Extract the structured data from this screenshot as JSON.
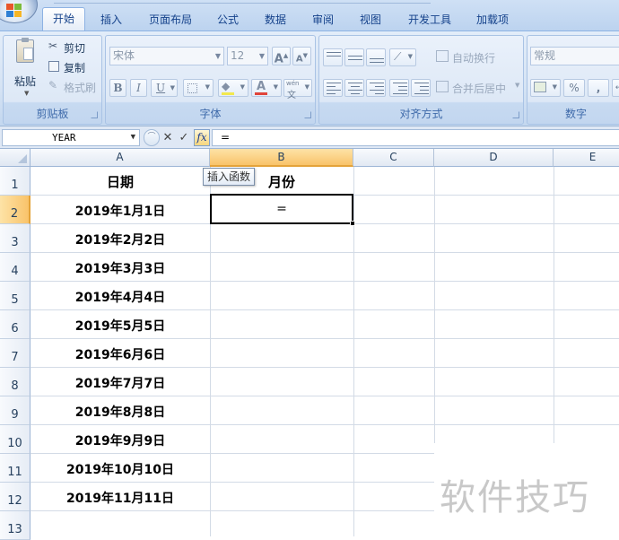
{
  "ribbon": {
    "tabs": [
      "开始",
      "插入",
      "页面布局",
      "公式",
      "数据",
      "审阅",
      "视图",
      "开发工具",
      "加载项"
    ],
    "active_tab": "开始",
    "clipboard": {
      "paste_label": "粘贴",
      "cut_label": "剪切",
      "copy_label": "复制",
      "format_painter_label": "格式刷",
      "group_label": "剪贴板"
    },
    "font": {
      "font_name": "宋体",
      "font_size": "12",
      "bold": "B",
      "italic": "I",
      "underline": "U",
      "grow": "A",
      "shrink": "A",
      "font_color_glyph": "A",
      "wen": "wén",
      "group_label": "字体"
    },
    "alignment": {
      "wrap_text_label": "自动换行",
      "merge_center_label": "合并后居中",
      "group_label": "对齐方式"
    },
    "number": {
      "format_value": "常规",
      "percent": "%",
      "comma": ",",
      "group_label": "数字"
    }
  },
  "formula_bar": {
    "name_box": "YEAR",
    "cancel_glyph": "✕",
    "enter_glyph": "✓",
    "fx_label": "fx",
    "formula": "="
  },
  "tooltip": "插入函数",
  "sheet": {
    "columns": [
      "A",
      "B",
      "C",
      "D",
      "E"
    ],
    "selected_column": "B",
    "rows": [
      "1",
      "2",
      "3",
      "4",
      "5",
      "6",
      "7",
      "8",
      "9",
      "10",
      "11",
      "12",
      "13"
    ],
    "selected_row": "2",
    "header": {
      "a1": "日期",
      "b1": "月份"
    },
    "dates": [
      "2019年1月1日",
      "2019年2月2日",
      "2019年3月3日",
      "2019年4月4日",
      "2019年5月5日",
      "2019年6月6日",
      "2019年7月7日",
      "2019年8月8日",
      "2019年9月9日",
      "2019年10月10日",
      "2019年11月11日"
    ],
    "active_cell_value": "="
  },
  "watermark": "软件技巧",
  "colors": {
    "ribbon_bg": "#d5e3f4",
    "selected_header": "#f9c36a",
    "grid_line": "#d3dbe6",
    "watermark": "#c8c8c8"
  }
}
